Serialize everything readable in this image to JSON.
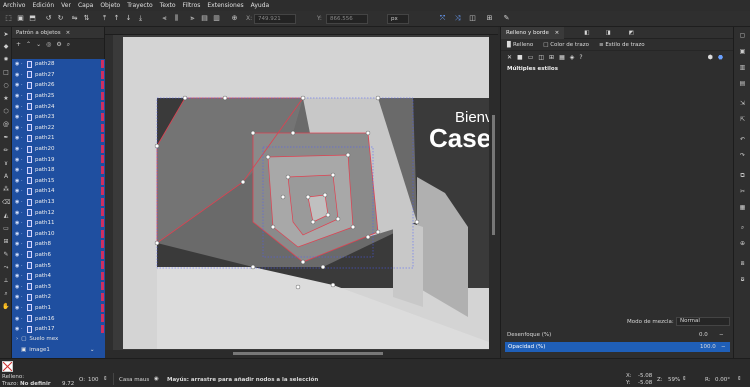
{
  "menu": [
    "Archivo",
    "Edición",
    "Ver",
    "Capa",
    "Objeto",
    "Trayecto",
    "Texto",
    "Filtros",
    "Extensiones",
    "Ayuda"
  ],
  "toolctl": {
    "x_label": "X:",
    "x_value": "749.921",
    "y_label": "Y:",
    "y_value": "866.556",
    "unit": "px"
  },
  "objects_panel": {
    "tab_label": "Patrón a objetos",
    "items": [
      "path28",
      "path27",
      "path26",
      "path25",
      "path24",
      "path23",
      "path22",
      "path21",
      "path20",
      "path19",
      "path18",
      "path15",
      "path14",
      "path13",
      "path12",
      "path11",
      "path10",
      "path8",
      "path6",
      "path5",
      "path4",
      "path3",
      "path2",
      "path1",
      "path16",
      "path17"
    ],
    "groups": [
      "Suelo mex",
      "image1"
    ]
  },
  "right_panel": {
    "tab_label": "Relleno y borde",
    "subtabs": [
      "Relleno",
      "Color de trazo",
      "Estilo de trazo"
    ],
    "multi_label": "Múltiples estilos",
    "blend_label": "Modo de mezcla:",
    "blend_value": "Normal",
    "blur_label": "Desenfoque (%)",
    "blur_value": "0.0",
    "opacity_label": "Opacidad (%)",
    "opacity_value": "100.0"
  },
  "canvas_text": {
    "line1": "Bienv",
    "line2": "Case"
  },
  "status": {
    "fill_label": "Relleno:",
    "stroke_label": "Trazo:",
    "stroke_value": "No definir",
    "stroke_width": "9.72",
    "opacity_label": "O:",
    "opacity_value": "100",
    "layer_name": "Casa maus",
    "hint": "Mayús: arrastre para añadir nodos a la selección",
    "x_label": "X:",
    "x_value": "-5.08",
    "y_label": "Y:",
    "y_value": "-5.08",
    "zoom_label": "Z:",
    "zoom_value": "59%",
    "rot_label": "R:",
    "rot_value": "0.00°"
  },
  "colors": {
    "accent": "#1f5fb8",
    "selection_red": "#e04050",
    "panel": "#2e2e2e"
  }
}
